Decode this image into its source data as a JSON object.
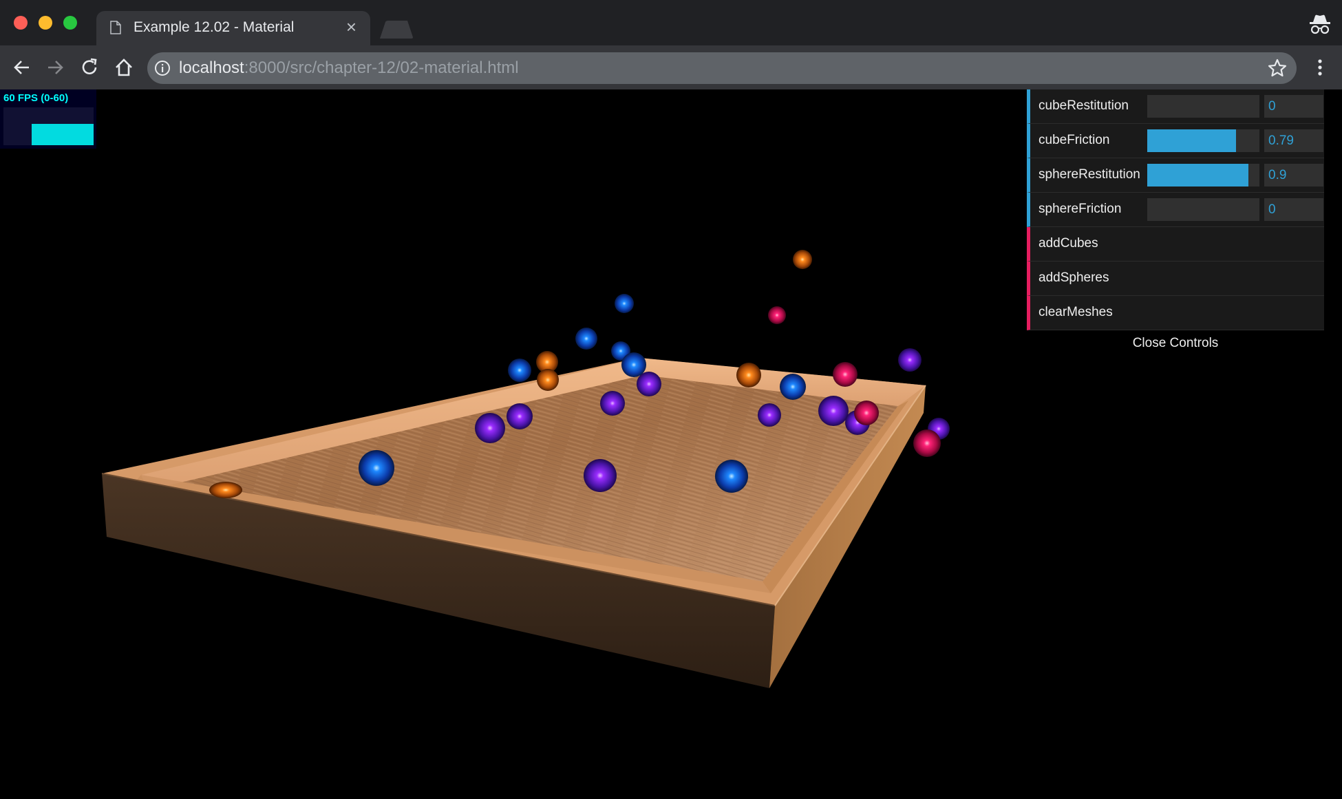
{
  "browser": {
    "tab_title": "Example 12.02 - Material",
    "tab_close": "×",
    "url_host": "localhost",
    "url_rest": ":8000/src/chapter-12/02-material.html",
    "icons": [
      "page-icon",
      "back-icon",
      "forward-icon",
      "reload-icon",
      "home-icon",
      "info-icon",
      "star-icon",
      "kebab-menu-icon",
      "incognito-icon"
    ]
  },
  "stats": {
    "fps_label": "60 FPS (0-60)"
  },
  "gui": {
    "controllers": [
      {
        "label": "cubeRestitution",
        "value": "0",
        "fraction": 0
      },
      {
        "label": "cubeFriction",
        "value": "0.79",
        "fraction": 0.79
      },
      {
        "label": "sphereRestitution",
        "value": "0.9",
        "fraction": 0.9
      },
      {
        "label": "sphereFriction",
        "value": "0",
        "fraction": 0
      }
    ],
    "buttons": [
      {
        "label": "addCubes"
      },
      {
        "label": "addSpheres"
      },
      {
        "label": "clearMeshes"
      }
    ],
    "close_label": "Close Controls",
    "colors": {
      "number": "#2fa1d6",
      "function": "#e61d5f",
      "panel": "#1a1a1a"
    }
  },
  "scene": {
    "ball_colors": {
      "blue": "#1e88ff",
      "purple": "#9a2cff",
      "orange": "#ff8a1e",
      "pink": "#ff2277"
    }
  }
}
